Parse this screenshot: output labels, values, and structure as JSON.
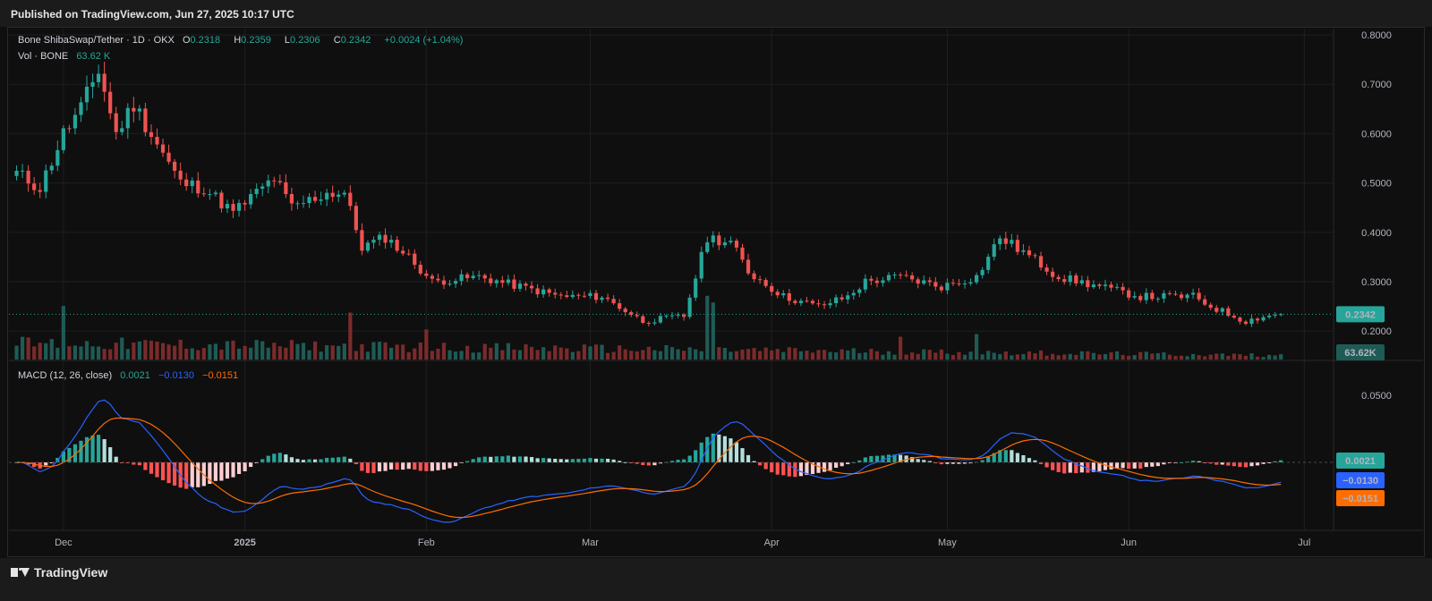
{
  "header": {
    "published": "Published on TradingView.com, Jun 27, 2025 10:17 UTC"
  },
  "footer": {
    "brand": "TradingView"
  },
  "legend": {
    "symbol": "Bone ShibaSwap/Tether · 1D · OKX",
    "o_label": "O",
    "o": "0.2318",
    "h_label": "H",
    "h": "0.2359",
    "l_label": "L",
    "l": "0.2306",
    "c_label": "C",
    "c": "0.2342",
    "change": "+0.0024 (+1.04%)",
    "vol_label": "Vol · BONE",
    "vol": "63.62 K",
    "macd_label": "MACD (12, 26, close)",
    "macd_hist": "0.0021",
    "macd_line": "−0.0130",
    "macd_signal": "−0.0151"
  },
  "colors": {
    "up": "#26a69a",
    "down": "#ef5350",
    "macd": "#2962ff",
    "signal": "#ff6d00",
    "bg": "#0f0f0f",
    "grid": "#1f1f1f"
  },
  "chart_data": [
    {
      "type": "candlestick",
      "title": "Bone ShibaSwap/Tether · 1D · OKX",
      "x_ticks": [
        "Dec",
        "2025",
        "Feb",
        "Mar",
        "Apr",
        "May",
        "Jun",
        "Jul"
      ],
      "y_ticks": [
        "0.8000",
        "0.7000",
        "0.6000",
        "0.5000",
        "0.4000",
        "0.3000",
        "0.2000"
      ],
      "ylim": [
        0.17,
        0.82
      ],
      "last_price": "0.2342",
      "last_volume": "63.62K",
      "anchors": [
        [
          "2024-11-23",
          0.52
        ],
        [
          "2024-11-27",
          0.49
        ],
        [
          "2024-12-01",
          0.6
        ],
        [
          "2024-12-04",
          0.65
        ],
        [
          "2024-12-07",
          0.73
        ],
        [
          "2024-12-10",
          0.6
        ],
        [
          "2024-12-13",
          0.66
        ],
        [
          "2024-12-17",
          0.58
        ],
        [
          "2024-12-21",
          0.5
        ],
        [
          "2024-12-25",
          0.49
        ],
        [
          "2024-12-30",
          0.44
        ],
        [
          "2025-01-03",
          0.48
        ],
        [
          "2025-01-06",
          0.51
        ],
        [
          "2025-01-09",
          0.45
        ],
        [
          "2025-01-15",
          0.48
        ],
        [
          "2025-01-18",
          0.48
        ],
        [
          "2025-01-21",
          0.37
        ],
        [
          "2025-01-25",
          0.39
        ],
        [
          "2025-01-29",
          0.35
        ],
        [
          "2025-02-02",
          0.3
        ],
        [
          "2025-02-10",
          0.31
        ],
        [
          "2025-02-24",
          0.27
        ],
        [
          "2025-03-03",
          0.27
        ],
        [
          "2025-03-10",
          0.22
        ],
        [
          "2025-03-17",
          0.23
        ],
        [
          "2025-03-21",
          0.39
        ],
        [
          "2025-03-25",
          0.38
        ],
        [
          "2025-03-28",
          0.32
        ],
        [
          "2025-04-03",
          0.27
        ],
        [
          "2025-04-09",
          0.25
        ],
        [
          "2025-04-14",
          0.27
        ],
        [
          "2025-04-17",
          0.3
        ],
        [
          "2025-04-23",
          0.31
        ],
        [
          "2025-04-30",
          0.29
        ],
        [
          "2025-05-06",
          0.31
        ],
        [
          "2025-05-10",
          0.39
        ],
        [
          "2025-05-14",
          0.36
        ],
        [
          "2025-05-20",
          0.31
        ],
        [
          "2025-05-27",
          0.29
        ],
        [
          "2025-06-03",
          0.27
        ],
        [
          "2025-06-08",
          0.27
        ],
        [
          "2025-06-12",
          0.27
        ],
        [
          "2025-06-15",
          0.25
        ],
        [
          "2025-06-21",
          0.22
        ],
        [
          "2025-06-24",
          0.23
        ],
        [
          "2025-06-27",
          0.2342
        ]
      ],
      "volume_spikes": [
        [
          "2024-12-01",
          0.8
        ],
        [
          "2025-01-19",
          0.7
        ],
        [
          "2025-02-01",
          0.45
        ],
        [
          "2025-03-21",
          0.95
        ],
        [
          "2025-03-22",
          0.85
        ],
        [
          "2025-04-23",
          0.34
        ],
        [
          "2025-05-06",
          0.38
        ]
      ]
    },
    {
      "type": "macd",
      "title": "MACD (12, 26, close)",
      "y_ticks": [
        "0.0500"
      ],
      "histogram_last": "0.0021",
      "macd_last": "−0.0130",
      "signal_last": "−0.0151"
    }
  ]
}
